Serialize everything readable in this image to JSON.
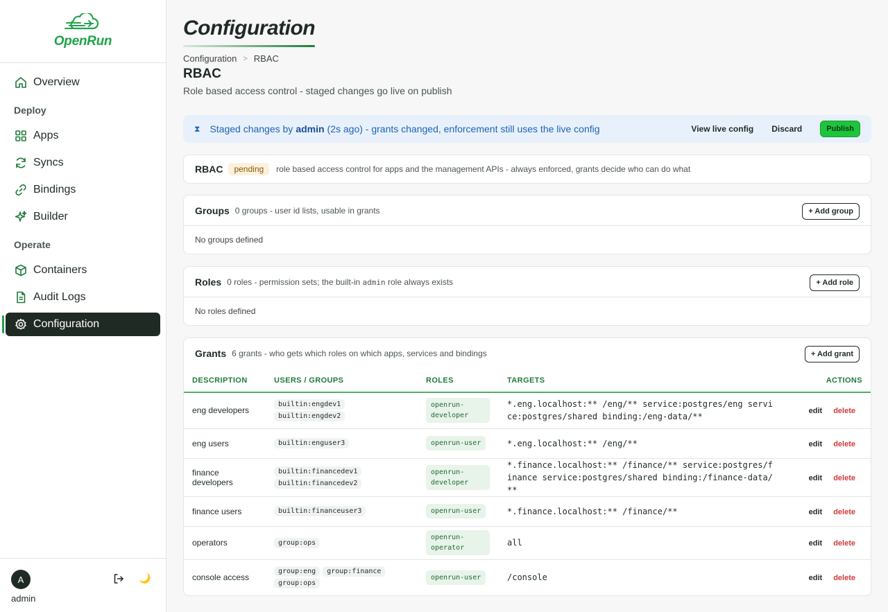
{
  "brand": {
    "name": "OpenRun"
  },
  "nav": {
    "overview": "Overview",
    "deploy_section": "Deploy",
    "apps": "Apps",
    "syncs": "Syncs",
    "bindings": "Bindings",
    "builder": "Builder",
    "operate_section": "Operate",
    "containers": "Containers",
    "audit_logs": "Audit Logs",
    "configuration": "Configuration"
  },
  "user": {
    "initial": "A",
    "name": "admin"
  },
  "page": {
    "title": "Configuration",
    "breadcrumb": [
      "Configuration",
      "RBAC"
    ],
    "section_title": "RBAC",
    "section_subtitle": "Role based access control - staged changes go live on publish"
  },
  "banner": {
    "prefix": "Staged changes by",
    "user": "admin",
    "suffix": "(2s ago) - grants changed, enforcement still uses the live config",
    "view_live": "View live config",
    "discard": "Discard",
    "publish": "Publish"
  },
  "rbac_card": {
    "title": "RBAC",
    "badge": "pending",
    "desc": "role based access control for apps and the management APIs - always enforced, grants decide who can do what"
  },
  "groups_card": {
    "title": "Groups",
    "desc": "0 groups - user id lists, usable in grants",
    "add": "+ Add group",
    "empty": "No groups defined"
  },
  "roles_card": {
    "title": "Roles",
    "desc_pre": "0 roles - permission sets; the built-in",
    "desc_code": "admin",
    "desc_post": "role always exists",
    "add": "+ Add role",
    "empty": "No roles defined"
  },
  "grants_card": {
    "title": "Grants",
    "desc": "6 grants - who gets which roles on which apps, services and bindings",
    "add": "+ Add grant",
    "columns": [
      "DESCRIPTION",
      "USERS / GROUPS",
      "ROLES",
      "TARGETS",
      "ACTIONS"
    ],
    "edit_label": "edit",
    "delete_label": "delete",
    "rows": [
      {
        "description": "eng developers",
        "users": [
          "builtin:engdev1",
          "builtin:engdev2"
        ],
        "role": "openrun-developer",
        "targets": "*.eng.localhost:** /eng/** service:postgres/eng service:postgres/shared binding:/eng-data/**"
      },
      {
        "description": "eng users",
        "users": [
          "builtin:enguser3"
        ],
        "role": "openrun-user",
        "targets": "*.eng.localhost:** /eng/**"
      },
      {
        "description": "finance developers",
        "users": [
          "builtin:financedev1",
          "builtin:financedev2"
        ],
        "role": "openrun-developer",
        "targets": "*.finance.localhost:** /finance/** service:postgres/finance service:postgres/shared binding:/finance-data/**"
      },
      {
        "description": "finance users",
        "users": [
          "builtin:financeuser3"
        ],
        "role": "openrun-user",
        "targets": "*.finance.localhost:** /finance/**"
      },
      {
        "description": "operators",
        "users": [
          "group:ops"
        ],
        "role": "openrun-operator",
        "targets": "all"
      },
      {
        "description": "console access",
        "users": [
          "group:eng",
          "group:finance",
          "group:ops"
        ],
        "role": "openrun-user",
        "targets": "/console"
      }
    ]
  }
}
